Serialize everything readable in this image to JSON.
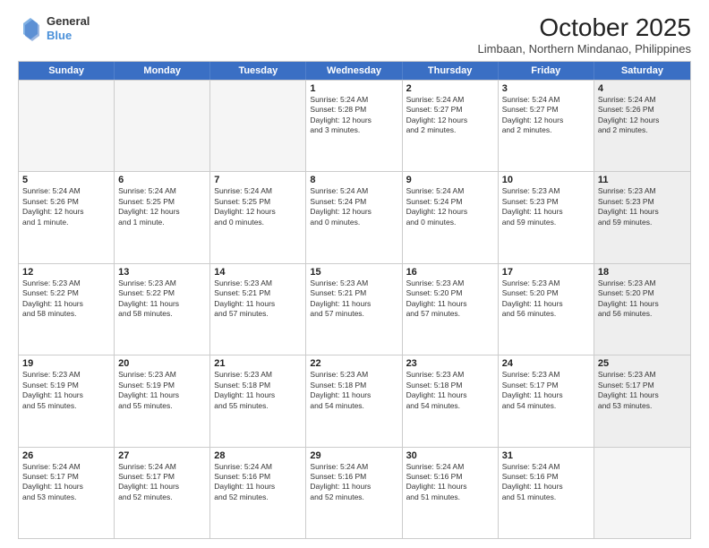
{
  "logo": {
    "line1": "General",
    "line2": "Blue"
  },
  "title": "October 2025",
  "subtitle": "Limbaan, Northern Mindanao, Philippines",
  "weekdays": [
    "Sunday",
    "Monday",
    "Tuesday",
    "Wednesday",
    "Thursday",
    "Friday",
    "Saturday"
  ],
  "weeks": [
    [
      {
        "day": "",
        "info": ""
      },
      {
        "day": "",
        "info": ""
      },
      {
        "day": "",
        "info": ""
      },
      {
        "day": "1",
        "info": "Sunrise: 5:24 AM\nSunset: 5:28 PM\nDaylight: 12 hours\nand 3 minutes."
      },
      {
        "day": "2",
        "info": "Sunrise: 5:24 AM\nSunset: 5:27 PM\nDaylight: 12 hours\nand 2 minutes."
      },
      {
        "day": "3",
        "info": "Sunrise: 5:24 AM\nSunset: 5:27 PM\nDaylight: 12 hours\nand 2 minutes."
      },
      {
        "day": "4",
        "info": "Sunrise: 5:24 AM\nSunset: 5:26 PM\nDaylight: 12 hours\nand 2 minutes."
      }
    ],
    [
      {
        "day": "5",
        "info": "Sunrise: 5:24 AM\nSunset: 5:26 PM\nDaylight: 12 hours\nand 1 minute."
      },
      {
        "day": "6",
        "info": "Sunrise: 5:24 AM\nSunset: 5:25 PM\nDaylight: 12 hours\nand 1 minute."
      },
      {
        "day": "7",
        "info": "Sunrise: 5:24 AM\nSunset: 5:25 PM\nDaylight: 12 hours\nand 0 minutes."
      },
      {
        "day": "8",
        "info": "Sunrise: 5:24 AM\nSunset: 5:24 PM\nDaylight: 12 hours\nand 0 minutes."
      },
      {
        "day": "9",
        "info": "Sunrise: 5:24 AM\nSunset: 5:24 PM\nDaylight: 12 hours\nand 0 minutes."
      },
      {
        "day": "10",
        "info": "Sunrise: 5:23 AM\nSunset: 5:23 PM\nDaylight: 11 hours\nand 59 minutes."
      },
      {
        "day": "11",
        "info": "Sunrise: 5:23 AM\nSunset: 5:23 PM\nDaylight: 11 hours\nand 59 minutes."
      }
    ],
    [
      {
        "day": "12",
        "info": "Sunrise: 5:23 AM\nSunset: 5:22 PM\nDaylight: 11 hours\nand 58 minutes."
      },
      {
        "day": "13",
        "info": "Sunrise: 5:23 AM\nSunset: 5:22 PM\nDaylight: 11 hours\nand 58 minutes."
      },
      {
        "day": "14",
        "info": "Sunrise: 5:23 AM\nSunset: 5:21 PM\nDaylight: 11 hours\nand 57 minutes."
      },
      {
        "day": "15",
        "info": "Sunrise: 5:23 AM\nSunset: 5:21 PM\nDaylight: 11 hours\nand 57 minutes."
      },
      {
        "day": "16",
        "info": "Sunrise: 5:23 AM\nSunset: 5:20 PM\nDaylight: 11 hours\nand 57 minutes."
      },
      {
        "day": "17",
        "info": "Sunrise: 5:23 AM\nSunset: 5:20 PM\nDaylight: 11 hours\nand 56 minutes."
      },
      {
        "day": "18",
        "info": "Sunrise: 5:23 AM\nSunset: 5:20 PM\nDaylight: 11 hours\nand 56 minutes."
      }
    ],
    [
      {
        "day": "19",
        "info": "Sunrise: 5:23 AM\nSunset: 5:19 PM\nDaylight: 11 hours\nand 55 minutes."
      },
      {
        "day": "20",
        "info": "Sunrise: 5:23 AM\nSunset: 5:19 PM\nDaylight: 11 hours\nand 55 minutes."
      },
      {
        "day": "21",
        "info": "Sunrise: 5:23 AM\nSunset: 5:18 PM\nDaylight: 11 hours\nand 55 minutes."
      },
      {
        "day": "22",
        "info": "Sunrise: 5:23 AM\nSunset: 5:18 PM\nDaylight: 11 hours\nand 54 minutes."
      },
      {
        "day": "23",
        "info": "Sunrise: 5:23 AM\nSunset: 5:18 PM\nDaylight: 11 hours\nand 54 minutes."
      },
      {
        "day": "24",
        "info": "Sunrise: 5:23 AM\nSunset: 5:17 PM\nDaylight: 11 hours\nand 54 minutes."
      },
      {
        "day": "25",
        "info": "Sunrise: 5:23 AM\nSunset: 5:17 PM\nDaylight: 11 hours\nand 53 minutes."
      }
    ],
    [
      {
        "day": "26",
        "info": "Sunrise: 5:24 AM\nSunset: 5:17 PM\nDaylight: 11 hours\nand 53 minutes."
      },
      {
        "day": "27",
        "info": "Sunrise: 5:24 AM\nSunset: 5:17 PM\nDaylight: 11 hours\nand 52 minutes."
      },
      {
        "day": "28",
        "info": "Sunrise: 5:24 AM\nSunset: 5:16 PM\nDaylight: 11 hours\nand 52 minutes."
      },
      {
        "day": "29",
        "info": "Sunrise: 5:24 AM\nSunset: 5:16 PM\nDaylight: 11 hours\nand 52 minutes."
      },
      {
        "day": "30",
        "info": "Sunrise: 5:24 AM\nSunset: 5:16 PM\nDaylight: 11 hours\nand 51 minutes."
      },
      {
        "day": "31",
        "info": "Sunrise: 5:24 AM\nSunset: 5:16 PM\nDaylight: 11 hours\nand 51 minutes."
      },
      {
        "day": "",
        "info": ""
      }
    ]
  ]
}
